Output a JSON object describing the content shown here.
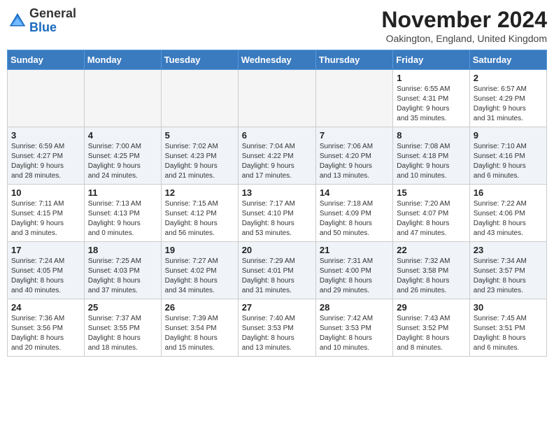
{
  "logo": {
    "general": "General",
    "blue": "Blue"
  },
  "title": "November 2024",
  "location": "Oakington, England, United Kingdom",
  "days_of_week": [
    "Sunday",
    "Monday",
    "Tuesday",
    "Wednesday",
    "Thursday",
    "Friday",
    "Saturday"
  ],
  "weeks": [
    [
      {
        "day": "",
        "info": ""
      },
      {
        "day": "",
        "info": ""
      },
      {
        "day": "",
        "info": ""
      },
      {
        "day": "",
        "info": ""
      },
      {
        "day": "",
        "info": ""
      },
      {
        "day": "1",
        "info": "Sunrise: 6:55 AM\nSunset: 4:31 PM\nDaylight: 9 hours\nand 35 minutes."
      },
      {
        "day": "2",
        "info": "Sunrise: 6:57 AM\nSunset: 4:29 PM\nDaylight: 9 hours\nand 31 minutes."
      }
    ],
    [
      {
        "day": "3",
        "info": "Sunrise: 6:59 AM\nSunset: 4:27 PM\nDaylight: 9 hours\nand 28 minutes."
      },
      {
        "day": "4",
        "info": "Sunrise: 7:00 AM\nSunset: 4:25 PM\nDaylight: 9 hours\nand 24 minutes."
      },
      {
        "day": "5",
        "info": "Sunrise: 7:02 AM\nSunset: 4:23 PM\nDaylight: 9 hours\nand 21 minutes."
      },
      {
        "day": "6",
        "info": "Sunrise: 7:04 AM\nSunset: 4:22 PM\nDaylight: 9 hours\nand 17 minutes."
      },
      {
        "day": "7",
        "info": "Sunrise: 7:06 AM\nSunset: 4:20 PM\nDaylight: 9 hours\nand 13 minutes."
      },
      {
        "day": "8",
        "info": "Sunrise: 7:08 AM\nSunset: 4:18 PM\nDaylight: 9 hours\nand 10 minutes."
      },
      {
        "day": "9",
        "info": "Sunrise: 7:10 AM\nSunset: 4:16 PM\nDaylight: 9 hours\nand 6 minutes."
      }
    ],
    [
      {
        "day": "10",
        "info": "Sunrise: 7:11 AM\nSunset: 4:15 PM\nDaylight: 9 hours\nand 3 minutes."
      },
      {
        "day": "11",
        "info": "Sunrise: 7:13 AM\nSunset: 4:13 PM\nDaylight: 9 hours\nand 0 minutes."
      },
      {
        "day": "12",
        "info": "Sunrise: 7:15 AM\nSunset: 4:12 PM\nDaylight: 8 hours\nand 56 minutes."
      },
      {
        "day": "13",
        "info": "Sunrise: 7:17 AM\nSunset: 4:10 PM\nDaylight: 8 hours\nand 53 minutes."
      },
      {
        "day": "14",
        "info": "Sunrise: 7:18 AM\nSunset: 4:09 PM\nDaylight: 8 hours\nand 50 minutes."
      },
      {
        "day": "15",
        "info": "Sunrise: 7:20 AM\nSunset: 4:07 PM\nDaylight: 8 hours\nand 47 minutes."
      },
      {
        "day": "16",
        "info": "Sunrise: 7:22 AM\nSunset: 4:06 PM\nDaylight: 8 hours\nand 43 minutes."
      }
    ],
    [
      {
        "day": "17",
        "info": "Sunrise: 7:24 AM\nSunset: 4:05 PM\nDaylight: 8 hours\nand 40 minutes."
      },
      {
        "day": "18",
        "info": "Sunrise: 7:25 AM\nSunset: 4:03 PM\nDaylight: 8 hours\nand 37 minutes."
      },
      {
        "day": "19",
        "info": "Sunrise: 7:27 AM\nSunset: 4:02 PM\nDaylight: 8 hours\nand 34 minutes."
      },
      {
        "day": "20",
        "info": "Sunrise: 7:29 AM\nSunset: 4:01 PM\nDaylight: 8 hours\nand 31 minutes."
      },
      {
        "day": "21",
        "info": "Sunrise: 7:31 AM\nSunset: 4:00 PM\nDaylight: 8 hours\nand 29 minutes."
      },
      {
        "day": "22",
        "info": "Sunrise: 7:32 AM\nSunset: 3:58 PM\nDaylight: 8 hours\nand 26 minutes."
      },
      {
        "day": "23",
        "info": "Sunrise: 7:34 AM\nSunset: 3:57 PM\nDaylight: 8 hours\nand 23 minutes."
      }
    ],
    [
      {
        "day": "24",
        "info": "Sunrise: 7:36 AM\nSunset: 3:56 PM\nDaylight: 8 hours\nand 20 minutes."
      },
      {
        "day": "25",
        "info": "Sunrise: 7:37 AM\nSunset: 3:55 PM\nDaylight: 8 hours\nand 18 minutes."
      },
      {
        "day": "26",
        "info": "Sunrise: 7:39 AM\nSunset: 3:54 PM\nDaylight: 8 hours\nand 15 minutes."
      },
      {
        "day": "27",
        "info": "Sunrise: 7:40 AM\nSunset: 3:53 PM\nDaylight: 8 hours\nand 13 minutes."
      },
      {
        "day": "28",
        "info": "Sunrise: 7:42 AM\nSunset: 3:53 PM\nDaylight: 8 hours\nand 10 minutes."
      },
      {
        "day": "29",
        "info": "Sunrise: 7:43 AM\nSunset: 3:52 PM\nDaylight: 8 hours\nand 8 minutes."
      },
      {
        "day": "30",
        "info": "Sunrise: 7:45 AM\nSunset: 3:51 PM\nDaylight: 8 hours\nand 6 minutes."
      }
    ]
  ]
}
